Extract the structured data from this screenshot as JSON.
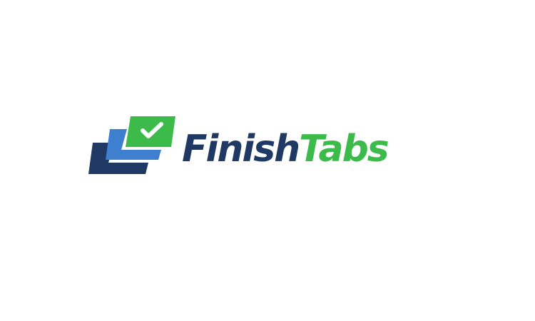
{
  "logo": {
    "wordmark_part_1": "Finish",
    "wordmark_part_2": "Tabs",
    "icon": "stacked-tabs-checkmark-icon"
  },
  "colors": {
    "background": "#ffffff",
    "navy": "#1f3864",
    "blue": "#3f7fd0",
    "green": "#3dbb4a",
    "check": "#ffffff"
  }
}
